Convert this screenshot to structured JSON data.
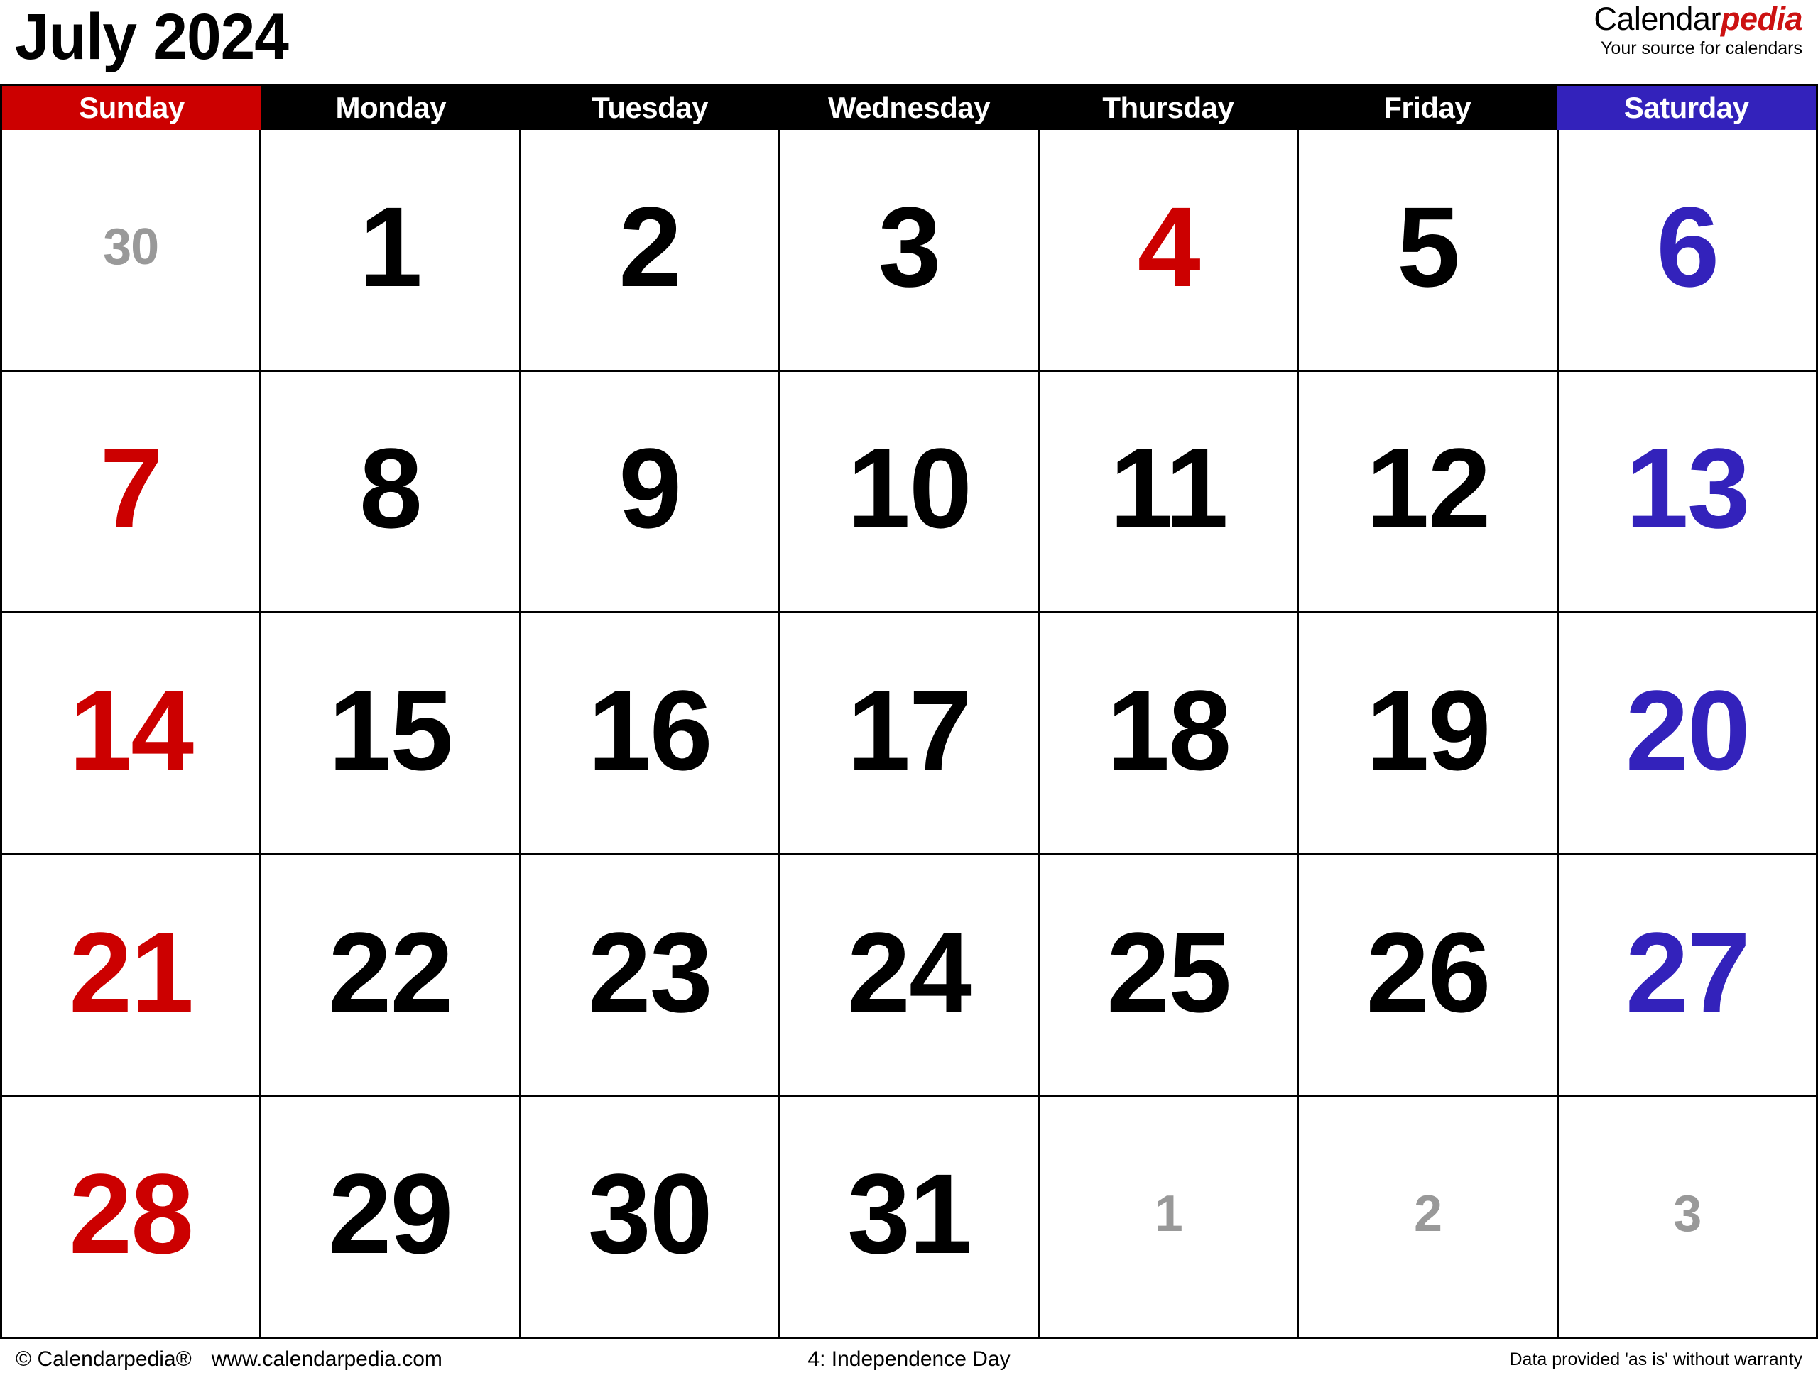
{
  "header": {
    "month_title": "July 2024",
    "brand_name_black": "Calendar",
    "brand_name_red": "pedia",
    "brand_tagline": "Your source for calendars"
  },
  "colors": {
    "sunday_bg": "#cc0000",
    "saturday_bg": "#3322bb",
    "weekday_bg": "#000000",
    "sunday_text": "#cc0000",
    "saturday_text": "#3322bb",
    "holiday_text": "#cc0000",
    "outside_month_text": "#999999",
    "default_text": "#000000",
    "grid_line": "#000000",
    "page_bg": "#ffffff"
  },
  "weekdays": [
    {
      "label": "Sunday",
      "kind": "sun"
    },
    {
      "label": "Monday",
      "kind": "wd"
    },
    {
      "label": "Tuesday",
      "kind": "wd"
    },
    {
      "label": "Wednesday",
      "kind": "wd"
    },
    {
      "label": "Thursday",
      "kind": "wd"
    },
    {
      "label": "Friday",
      "kind": "wd"
    },
    {
      "label": "Saturday",
      "kind": "sat"
    }
  ],
  "weeks": [
    [
      {
        "num": "30",
        "style": "out"
      },
      {
        "num": "1",
        "style": "normal"
      },
      {
        "num": "2",
        "style": "normal"
      },
      {
        "num": "3",
        "style": "normal"
      },
      {
        "num": "4",
        "style": "hol"
      },
      {
        "num": "5",
        "style": "normal"
      },
      {
        "num": "6",
        "style": "sat"
      }
    ],
    [
      {
        "num": "7",
        "style": "sun"
      },
      {
        "num": "8",
        "style": "normal"
      },
      {
        "num": "9",
        "style": "normal"
      },
      {
        "num": "10",
        "style": "normal"
      },
      {
        "num": "11",
        "style": "normal"
      },
      {
        "num": "12",
        "style": "normal"
      },
      {
        "num": "13",
        "style": "sat"
      }
    ],
    [
      {
        "num": "14",
        "style": "sun"
      },
      {
        "num": "15",
        "style": "normal"
      },
      {
        "num": "16",
        "style": "normal"
      },
      {
        "num": "17",
        "style": "normal"
      },
      {
        "num": "18",
        "style": "normal"
      },
      {
        "num": "19",
        "style": "normal"
      },
      {
        "num": "20",
        "style": "sat"
      }
    ],
    [
      {
        "num": "21",
        "style": "sun"
      },
      {
        "num": "22",
        "style": "normal"
      },
      {
        "num": "23",
        "style": "normal"
      },
      {
        "num": "24",
        "style": "normal"
      },
      {
        "num": "25",
        "style": "normal"
      },
      {
        "num": "26",
        "style": "normal"
      },
      {
        "num": "27",
        "style": "sat"
      }
    ],
    [
      {
        "num": "28",
        "style": "sun"
      },
      {
        "num": "29",
        "style": "normal"
      },
      {
        "num": "30",
        "style": "normal"
      },
      {
        "num": "31",
        "style": "normal"
      },
      {
        "num": "1",
        "style": "out"
      },
      {
        "num": "2",
        "style": "out"
      },
      {
        "num": "3",
        "style": "out"
      }
    ]
  ],
  "footer": {
    "copyright": "© Calendarpedia®",
    "website": "www.calendarpedia.com",
    "holiday_note": "4: Independence Day",
    "disclaimer": "Data provided 'as is' without warranty"
  }
}
